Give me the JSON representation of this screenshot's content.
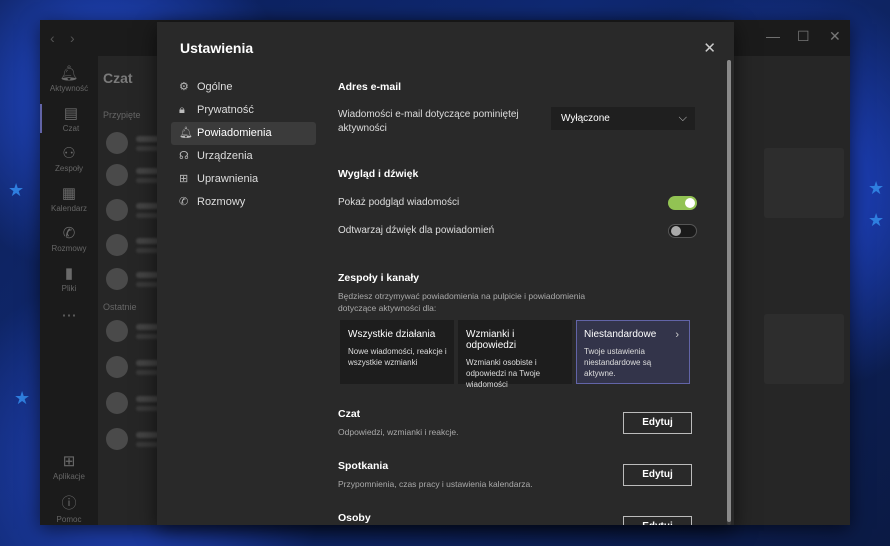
{
  "rail": {
    "activity": "Aktywność",
    "chat": "Czat",
    "teams": "Zespoły",
    "calendar": "Kalendarz",
    "calls": "Rozmowy",
    "files": "Pliki",
    "apps": "Aplikacje",
    "help": "Pomoc"
  },
  "chat_list": {
    "title": "Czat",
    "pinned": "Przypięte",
    "recent": "Ostatnie"
  },
  "settings": {
    "title": "Ustawienia",
    "nav": [
      {
        "label": "Ogólne",
        "icon": "gear-icon"
      },
      {
        "label": "Prywatność",
        "icon": "lock-icon"
      },
      {
        "label": "Powiadomienia",
        "icon": "bell-icon"
      },
      {
        "label": "Urządzenia",
        "icon": "headset-icon"
      },
      {
        "label": "Uprawnienia",
        "icon": "permissions-icon"
      },
      {
        "label": "Rozmowy",
        "icon": "phone-icon"
      }
    ],
    "email": {
      "heading": "Adres e-mail",
      "label": "Wiadomości e-mail dotyczące pominiętej aktywności",
      "value": "Wyłączone"
    },
    "appearance": {
      "heading": "Wygląd i dźwięk",
      "preview": "Pokaż podgląd wiadomości",
      "preview_on": true,
      "sound": "Odtwarzaj dźwięk dla powiadomień",
      "sound_on": false
    },
    "teams": {
      "heading": "Zespoły i kanały",
      "description": "Będziesz otrzymywać powiadomienia na pulpicie i powiadomienia dotyczące aktywności dla:",
      "cards": [
        {
          "title": "Wszystkie działania",
          "desc": "Nowe wiadomości, reakcje i wszystkie wzmianki"
        },
        {
          "title": "Wzmianki i odpowiedzi",
          "desc": "Wzmianki osobiste i odpowiedzi na Twoje wiadomości"
        },
        {
          "title": "Niestandardowe",
          "desc": "Twoje ustawienia niestandardowe są aktywne."
        }
      ]
    },
    "chat": {
      "heading": "Czat",
      "desc": "Odpowiedzi, wzmianki i reakcje.",
      "button": "Edytuj"
    },
    "meetings": {
      "heading": "Spotkania",
      "desc": "Przypomnienia, czas pracy i ustawienia kalendarza.",
      "button": "Edytuj"
    },
    "people": {
      "heading": "Osoby",
      "button": "Edytuj"
    }
  }
}
